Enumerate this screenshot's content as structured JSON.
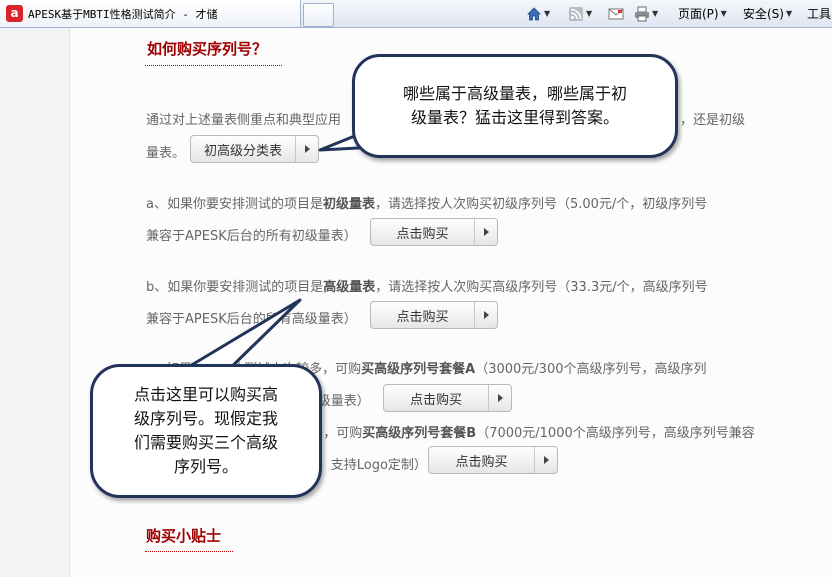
{
  "browser": {
    "tab_title": "APESK基于MBTI性格测试简介 - 才储",
    "logo_letter": "a",
    "toolbar": {
      "page_label": "页面(P)",
      "safety_label": "安全(S)",
      "tools_label": "工具"
    }
  },
  "section": {
    "heading": "如何购买序列号？",
    "intro_line1": "通过对上述量表侧重点和典型应用",
    "intro_line1_tail": "，还是初级",
    "intro_line2": "量表。",
    "classify_button": "初高级分类表",
    "item_a_line1_pre": "a、如果你要安排测试的项目是",
    "item_a_bold": "初级量表",
    "item_a_line1_post": "，请选择按人次购买初级序列号（5.00元/个，初级序列号",
    "item_a_line2": "兼容于APESK后台的所有初级量表）",
    "item_a_button": "点击购买",
    "item_b_line1_pre": "b、如果你要安排测试的项目是",
    "item_b_bold": "高级量表",
    "item_b_line1_post": "，请选择按人次购买高级序列号（33.3元/个，高级序列号",
    "item_b_line2": "兼容于APESK后台的所有高级量表）",
    "item_b_button": "点击购买",
    "item_c_line1_pre": "c、如果要安排的测试人次较多，可购",
    "item_c_bold": "买高级序列号套餐A",
    "item_c_line1_post": "（3000元/300个高级序列号，高级序列",
    "item_c_line2": "号兼容于APESK后台的所有高级量表）",
    "item_c_button": "点击购买",
    "item_d_line1_pre": "d、如果要安排的测试人次很多，可购",
    "item_d_bold": "买高级序列号套餐B",
    "item_d_line1_post": "（7000元/1000个高级序列号，高级序列号兼容",
    "item_d_line2": "于APESK后台的所有高级量表，支持Logo定制）",
    "item_d_button": "点击购买",
    "tips_heading": "购买小贴士"
  },
  "callouts": {
    "top": [
      "哪些属于高级量表，哪些属于初",
      "级量表？猛击这里得到答案。"
    ],
    "bottom": [
      "点击这里可以购买高",
      "级序列号。现假定我",
      "们需要购买三个高级",
      "序列号。"
    ]
  }
}
